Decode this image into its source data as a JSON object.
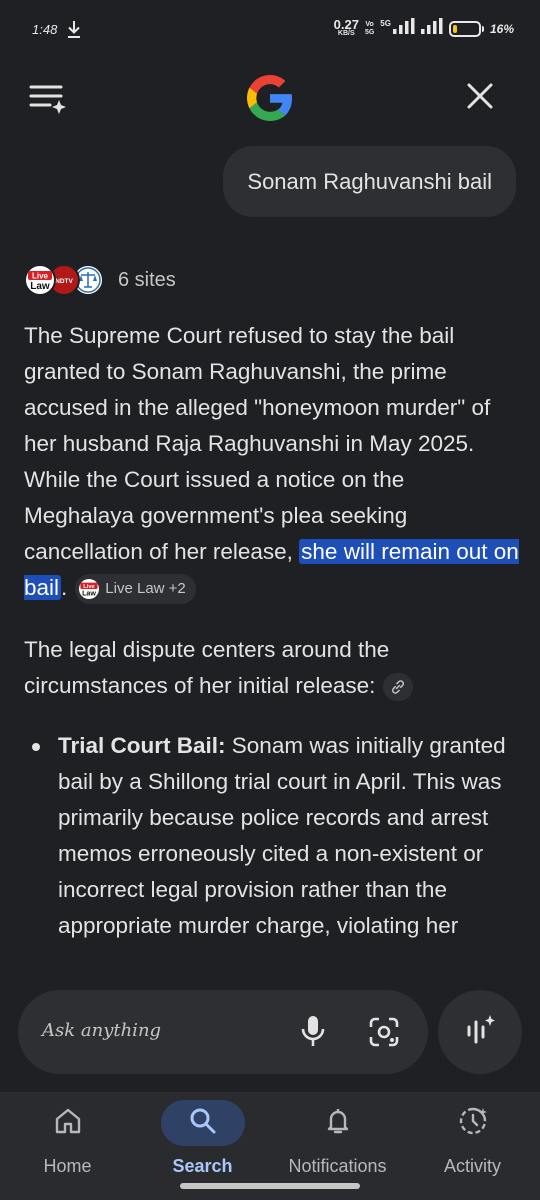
{
  "status_bar": {
    "time": "1:48",
    "speed_value": "0.27",
    "speed_unit": "KB/S",
    "vo_top": "Vo",
    "vo_bottom": "5G",
    "network": "5G",
    "battery_text": "16%",
    "battery_level": 0.16
  },
  "header": {
    "logo": "google-g-icon",
    "menu_icon": "menu-sparkle-icon",
    "close_icon": "close-icon"
  },
  "query": "Sonam Raghuvanshi bail",
  "sources": {
    "count_label": "6 sites",
    "logos": [
      "Live Law",
      "NDTV",
      "court-scales-icon"
    ]
  },
  "answer": {
    "para1_text": "The Supreme Court refused to stay the bail granted to Sonam Raghuvanshi, the prime accused in the alleged \"honeymoon murder\" of her husband Raja Raghuvanshi in May 2025. While the Court issued a notice on the Meghalaya government's plea seeking cancellation of her release, ",
    "para1_highlight": "she will remain out on bail",
    "para1_end": ".",
    "citation": "Live Law +2",
    "para2_text": "The legal dispute centers around the circumstances of her initial release:",
    "bullets": [
      {
        "heading": "Trial Court Bail:",
        "text": " Sonam was initially granted bail by a Shillong trial court in April. This was primarily because police records and arrest memos erroneously cited a non-existent or incorrect legal provision rather than the appropriate murder charge, violating her"
      }
    ]
  },
  "input": {
    "placeholder": "Ask anything"
  },
  "nav": {
    "items": [
      {
        "label": "Home",
        "icon": "home-icon"
      },
      {
        "label": "Search",
        "icon": "search-icon",
        "active": true
      },
      {
        "label": "Notifications",
        "icon": "bell-icon"
      },
      {
        "label": "Activity",
        "icon": "activity-icon"
      }
    ]
  },
  "colors": {
    "background": "#1f2023",
    "surface": "#2d2f33",
    "highlight": "#1e4fb8",
    "active_nav": "#a8c7fa"
  }
}
